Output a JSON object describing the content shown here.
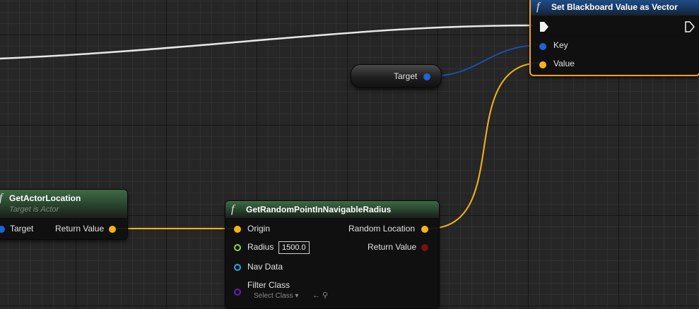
{
  "colors": {
    "exec_wire": "#e8e8e8",
    "vector_pin": "#f5b416",
    "object_pin": "#1c64d8",
    "float_pin": "#8ed44a",
    "nav_pin": "#28a9e0",
    "class_pin": "#6a1fb0",
    "bool_pin": "#7b1010",
    "selected_outline": "#f0a020",
    "function_header": "#3e6b44"
  },
  "nodes": {
    "set_blackboard": {
      "title": "Set Blackboard Value as Vector",
      "key_label": "Key",
      "value_label": "Value"
    },
    "target_variable": {
      "label": "Target"
    },
    "get_actor_location": {
      "title": "GetActorLocation",
      "subtitle": "Target is Actor",
      "target_label": "Target",
      "return_label": "Return Value"
    },
    "get_random_point": {
      "title": "GetRandomPointInNavigableRadius",
      "origin_label": "Origin",
      "radius_label": "Radius",
      "radius_value": "1500.0",
      "nav_data_label": "Nav Data",
      "filter_class_label": "Filter Class",
      "filter_class_select": "Select Class",
      "random_location_label": "Random Location",
      "return_label": "Return Value"
    }
  }
}
